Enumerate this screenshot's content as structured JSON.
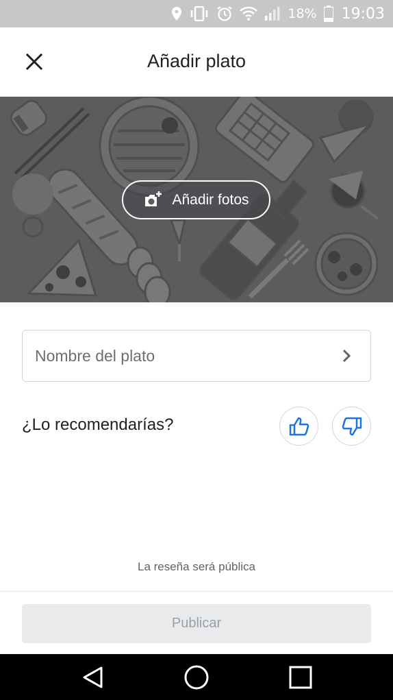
{
  "status_bar": {
    "battery_percent": "18%",
    "time": "19:03",
    "icons": [
      "location-icon",
      "vibrate-icon",
      "alarm-icon",
      "wifi-icon",
      "signal-icon",
      "battery-icon"
    ]
  },
  "app_bar": {
    "title": "Añadir plato",
    "close_icon": "close-icon"
  },
  "hero": {
    "add_photos_label": "Añadir fotos",
    "add_photos_icon": "add-photo-camera-icon",
    "background_color": "#5c5c5f"
  },
  "form": {
    "dish_name_placeholder": "Nombre del plato",
    "recommend_question": "¿Lo recomendarías?",
    "thumb_up_icon": "thumb-up-icon",
    "thumb_down_icon": "thumb-down-icon",
    "accent_color": "#1a73e8"
  },
  "footer": {
    "public_note": "La reseña será pública",
    "publish_label": "Publicar"
  },
  "nav_bar": {
    "icons": [
      "back-icon",
      "home-icon",
      "recent-apps-icon"
    ]
  }
}
